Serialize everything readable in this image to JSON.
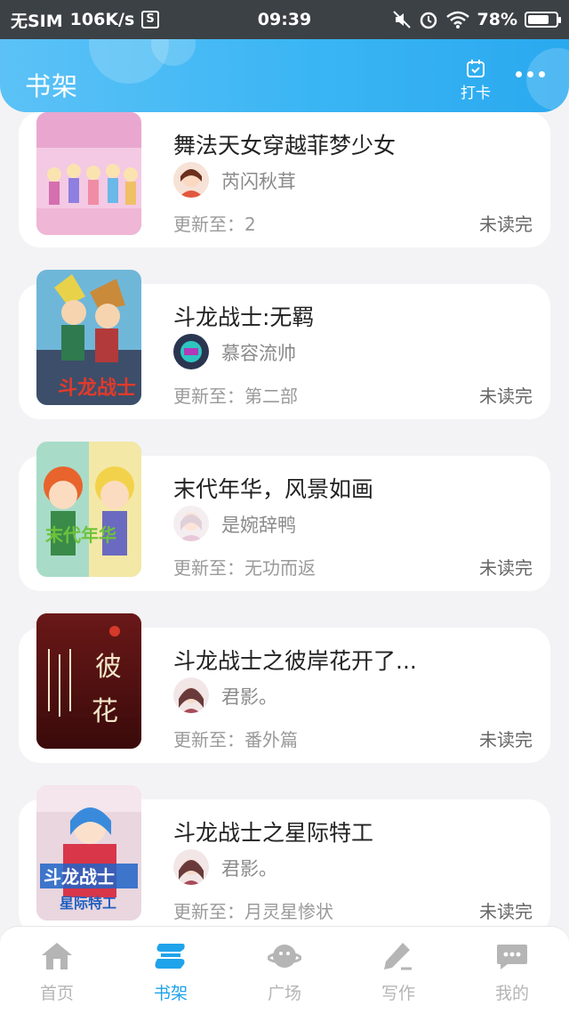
{
  "status_bar": {
    "carrier": "无SIM",
    "speed": "106K/s",
    "s_badge": "S",
    "time": "09:39",
    "battery": "78%",
    "battery_level": 0.78
  },
  "header": {
    "title": "书架",
    "checkin_label": "打卡",
    "accent_color": "#3ab5f4"
  },
  "books": [
    {
      "title": "舞法天女穿越菲梦少女",
      "author": "芮闪秋茸",
      "update": "更新至：2",
      "status": "未读完"
    },
    {
      "title": "斗龙战士:无羁",
      "author": "慕容流帅",
      "update": "更新至：第二部",
      "status": "未读完"
    },
    {
      "title": "末代年华，风景如画",
      "author": "是婉辞鸭",
      "update": "更新至：无功而返",
      "status": "未读完"
    },
    {
      "title": "斗龙战士之彼岸花开了...",
      "author": "君影。",
      "update": "更新至：番外篇",
      "status": "未读完"
    },
    {
      "title": "斗龙战士之星际特工",
      "author": "君影。",
      "update": "更新至：月灵星惨状",
      "status": "未读完"
    }
  ],
  "nav": {
    "items": [
      {
        "label": "首页",
        "icon": "home-icon"
      },
      {
        "label": "书架",
        "icon": "bookshelf-icon",
        "active": true
      },
      {
        "label": "广场",
        "icon": "planet-icon"
      },
      {
        "label": "写作",
        "icon": "pen-icon"
      },
      {
        "label": "我的",
        "icon": "chat-bubble-icon"
      }
    ],
    "active_color": "#1fa3ea",
    "inactive_color": "#b5b5b5"
  }
}
